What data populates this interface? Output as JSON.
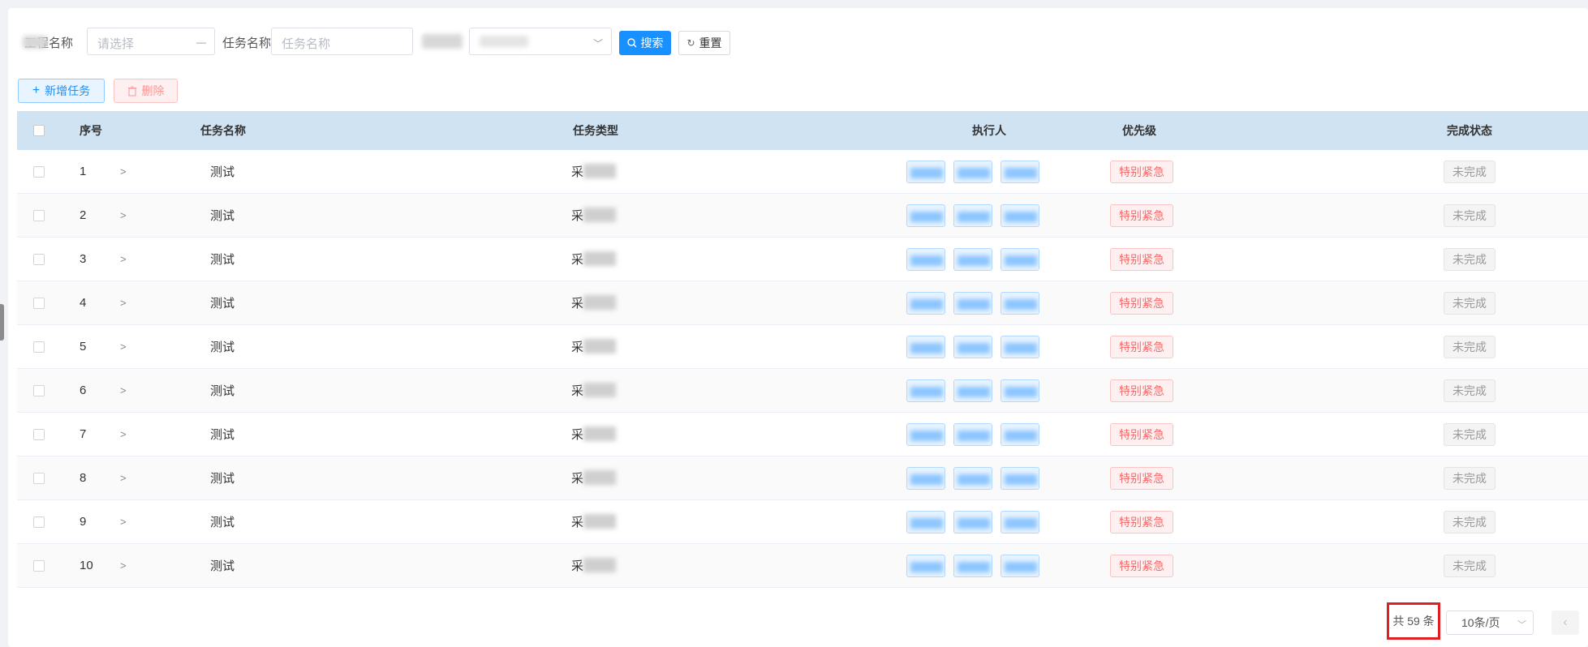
{
  "search": {
    "field1_label": "工程名称",
    "field1_placeholder": "请选择",
    "field2_label": "任务名称",
    "field2_placeholder": "任务名称",
    "field3_label": "",
    "field3_value": "",
    "search_button": "搜索",
    "reset_button": "重置"
  },
  "actions": {
    "add_button": "新增任务",
    "delete_button": "删除"
  },
  "table": {
    "headers": {
      "index": "序号",
      "name": "任务名称",
      "type": "任务类型",
      "executor": "执行人",
      "priority": "优先级",
      "status": "完成状态"
    },
    "rows": [
      {
        "index": "1",
        "name": "测试",
        "type": "采",
        "priority": "特别紧急",
        "status": "未完成"
      },
      {
        "index": "2",
        "name": "测试",
        "type": "采",
        "priority": "特别紧急",
        "status": "未完成"
      },
      {
        "index": "3",
        "name": "测试",
        "type": "采",
        "priority": "特别紧急",
        "status": "未完成"
      },
      {
        "index": "4",
        "name": "测试",
        "type": "采",
        "priority": "特别紧急",
        "status": "未完成"
      },
      {
        "index": "5",
        "name": "测试",
        "type": "采",
        "priority": "特别紧急",
        "status": "未完成"
      },
      {
        "index": "6",
        "name": "测试",
        "type": "采",
        "priority": "特别紧急",
        "status": "未完成"
      },
      {
        "index": "7",
        "name": "测试",
        "type": "采",
        "priority": "特别紧急",
        "status": "未完成"
      },
      {
        "index": "8",
        "name": "测试",
        "type": "采",
        "priority": "特别紧急",
        "status": "未完成"
      },
      {
        "index": "9",
        "name": "测试",
        "type": "采",
        "priority": "特别紧急",
        "status": "未完成"
      },
      {
        "index": "10",
        "name": "测试",
        "type": "采",
        "priority": "特别紧急",
        "status": "未完成"
      }
    ]
  },
  "pagination": {
    "total": "共 59 条",
    "page_size": "10条/页"
  },
  "colors": {
    "primary": "#1890ff",
    "header_bg": "#cfe3f3",
    "urgent": "#f56c6c",
    "highlight_box": "#e02020"
  }
}
